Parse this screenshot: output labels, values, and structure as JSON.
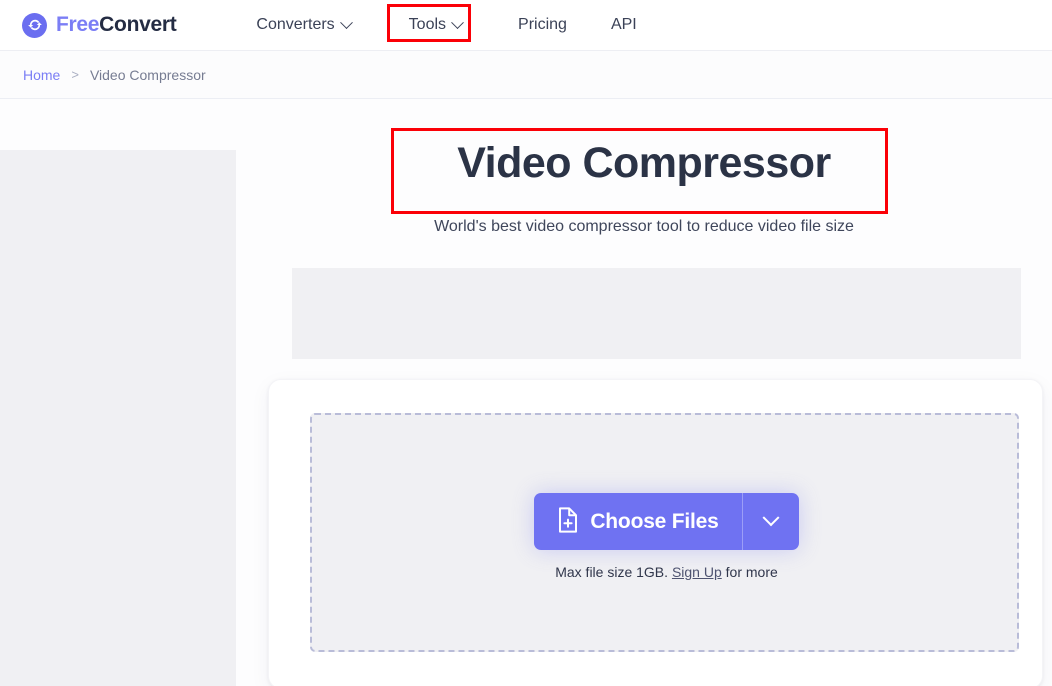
{
  "brand": {
    "icon": "refresh-circle-icon",
    "name_part1": "Free",
    "name_part2": "Convert"
  },
  "nav": {
    "items": [
      {
        "label": "Converters",
        "has_dropdown": true,
        "icon": "chevron-down-icon"
      },
      {
        "label": "Tools",
        "has_dropdown": true,
        "icon": "chevron-down-icon"
      },
      {
        "label": "Pricing",
        "has_dropdown": false
      },
      {
        "label": "API",
        "has_dropdown": false
      }
    ]
  },
  "breadcrumb": {
    "home": "Home",
    "separator": ">",
    "current": "Video Compressor"
  },
  "main": {
    "title": "Video Compressor",
    "subtitle": "World's best video compressor tool to reduce video file size"
  },
  "upload": {
    "choose_label": "Choose Files",
    "file_icon": "file-plus-icon",
    "dropdown_icon": "chevron-down-icon",
    "max_size_prefix": "Max file size 1GB.",
    "signup_link": "Sign Up",
    "max_size_suffix": "for more"
  },
  "annotations": {
    "tools_highlight_color": "#fb0007",
    "title_highlight_color": "#fb0007"
  },
  "colors": {
    "brand_purple": "#7b7ef5",
    "brand_dark": "#242c43",
    "button_purple": "#6f72f2",
    "placeholder_gray": "#f0f0f3",
    "dashed_border": "#b9bcd8"
  }
}
